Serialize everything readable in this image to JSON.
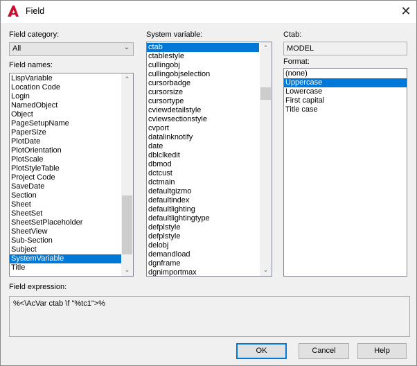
{
  "window": {
    "title": "Field",
    "close": "✕",
    "accent": "#0078d7",
    "logo_color": "#c8102e"
  },
  "field_category": {
    "label": "Field category:",
    "value": "All"
  },
  "field_names": {
    "label": "Field names:",
    "items": [
      "LispVariable",
      "Location Code",
      "Login",
      "NamedObject",
      "Object",
      "PageSetupName",
      "PaperSize",
      "PlotDate",
      "PlotOrientation",
      "PlotScale",
      "PlotStyleTable",
      "Project Code",
      "SaveDate",
      "Section",
      "Sheet",
      "SheetSet",
      "SheetSetPlaceholder",
      "SheetView",
      "Sub-Section",
      "Subject",
      "SystemVariable",
      "Title"
    ],
    "selected": "SystemVariable"
  },
  "system_variable": {
    "label": "System variable:",
    "items": [
      "ctab",
      "ctablestyle",
      "cullingobj",
      "cullingobjselection",
      "cursorbadge",
      "cursorsize",
      "cursortype",
      "cviewdetailstyle",
      "cviewsectionstyle",
      "cvport",
      "datalinknotify",
      "date",
      "dblclkedit",
      "dbmod",
      "dctcust",
      "dctmain",
      "defaultgizmo",
      "defaultindex",
      "defaultlighting",
      "defaultlightingtype",
      "defplstyle",
      "defplstyle",
      "delobj",
      "demandload",
      "dgnframe",
      "dgnimportmax"
    ],
    "selected": "ctab"
  },
  "ctab": {
    "label": "Ctab:",
    "value": "MODEL"
  },
  "format": {
    "label": "Format:",
    "items": [
      "(none)",
      "Uppercase",
      "Lowercase",
      "First capital",
      "Title case"
    ],
    "selected": "Uppercase"
  },
  "expression": {
    "label": "Field expression:",
    "value": "%<\\AcVar ctab \\f \"%tc1\">%"
  },
  "buttons": {
    "ok": "OK",
    "cancel": "Cancel",
    "help": "Help"
  }
}
